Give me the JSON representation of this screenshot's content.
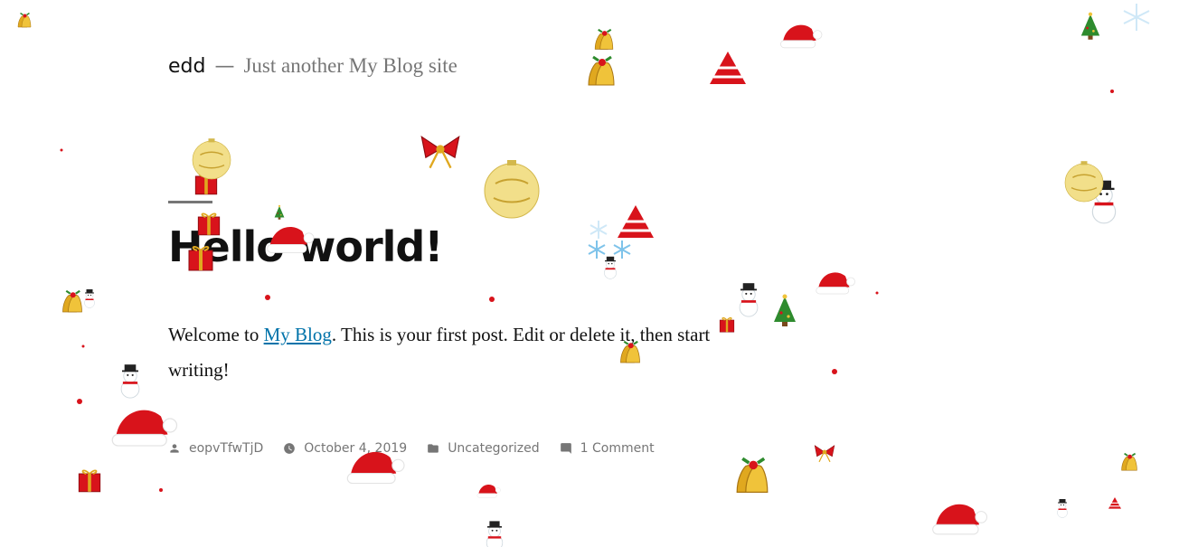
{
  "header": {
    "site_title": "edd",
    "separator": "—",
    "site_description": "Just another My Blog site"
  },
  "post": {
    "title": "Hello world!",
    "content_before_link": "Welcome to ",
    "content_link": "My Blog",
    "content_after_link": ". This is your first post. Edit or delete it, then start writing!"
  },
  "meta": {
    "author": "eopvTfwTjD",
    "date": "October 4, 2019",
    "category": "Uncategorized",
    "comments": "1 Comment"
  },
  "icons": {
    "author": "person-icon",
    "date": "clock-icon",
    "category": "folder-icon",
    "comments": "comment-icon"
  },
  "colors": {
    "text": "#111111",
    "muted": "#767676",
    "link": "#0073aa",
    "santa_red": "#d8131b",
    "bell_gold": "#e0a81f",
    "tree_green": "#2e8b2e"
  },
  "decorations": {
    "santa_hats": 11,
    "bells": 6,
    "snowmen": 6,
    "trees": 4,
    "bows": 2,
    "gift_boxes": 4,
    "ornaments": 3
  }
}
